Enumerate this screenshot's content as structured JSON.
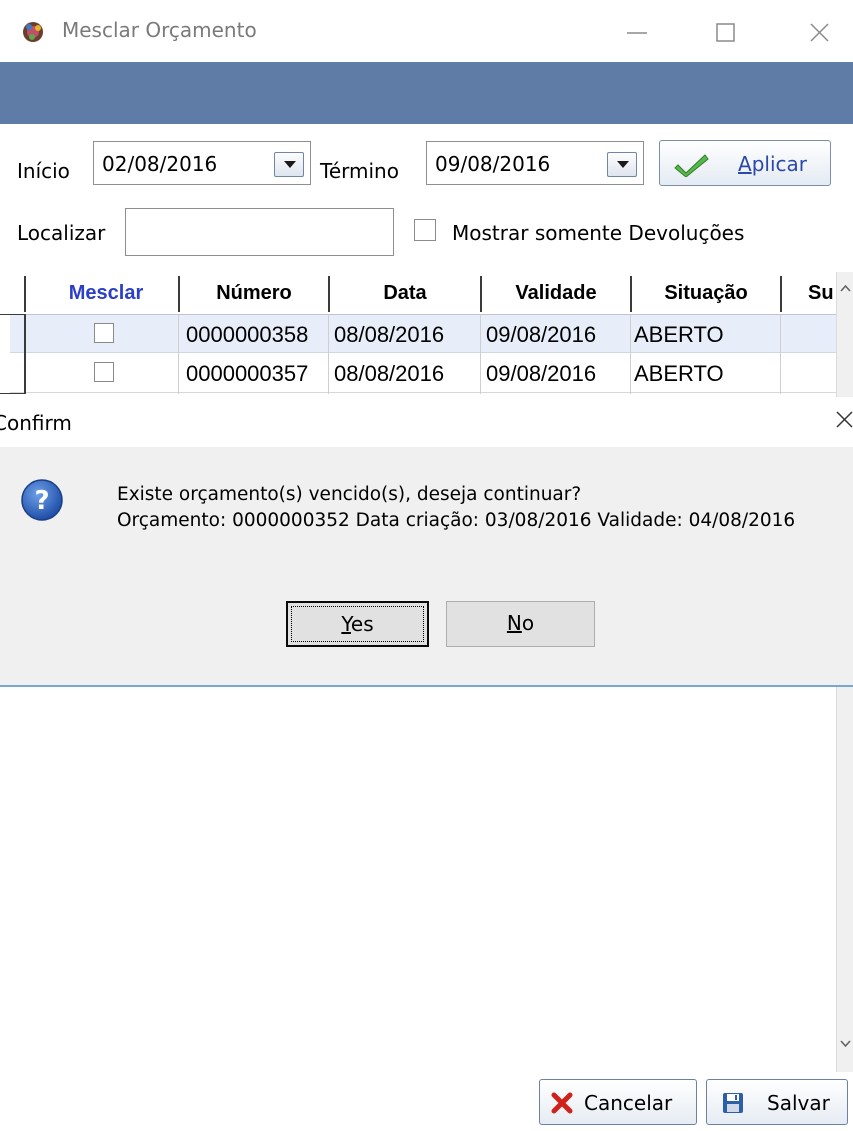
{
  "window": {
    "title": "Mesclar Orçamento",
    "controls": [
      "minimize",
      "maximize",
      "close"
    ]
  },
  "filters": {
    "start_label": "Início",
    "start_value": "02/08/2016",
    "end_label": "Término",
    "end_value": "09/08/2016",
    "apply_label_accel": "A",
    "apply_label_rest": "plicar",
    "search_label": "Localizar",
    "search_value": "",
    "returns_only_label": "Mostrar somente Devoluções",
    "returns_only_checked": false
  },
  "grid": {
    "columns": [
      "Mesclar",
      "Número",
      "Data",
      "Validade",
      "Situação",
      "Su"
    ],
    "rows": [
      {
        "mesclar": false,
        "numero": "0000000358",
        "data": "08/08/2016",
        "validade": "09/08/2016",
        "situacao": "ABERTO"
      },
      {
        "mesclar": false,
        "numero": "0000000357",
        "data": "08/08/2016",
        "validade": "09/08/2016",
        "situacao": "ABERTO"
      }
    ]
  },
  "dialog": {
    "title": "Confirm",
    "message_line1": "Existe orçamento(s) vencido(s), deseja continuar?",
    "message_line2": "Orçamento: 0000000352 Data criação: 03/08/2016 Validade: 04/08/2016",
    "yes_accel": "Y",
    "yes_rest": "es",
    "no_accel": "N",
    "no_rest": "o",
    "icon": "question-icon"
  },
  "footer": {
    "cancel_label": "Cancelar",
    "save_label": "Salvar"
  },
  "colors": {
    "header_band": "#5f7ca6",
    "mesclar_header": "#2b3fc7",
    "row_selected": "#e8eef9"
  }
}
